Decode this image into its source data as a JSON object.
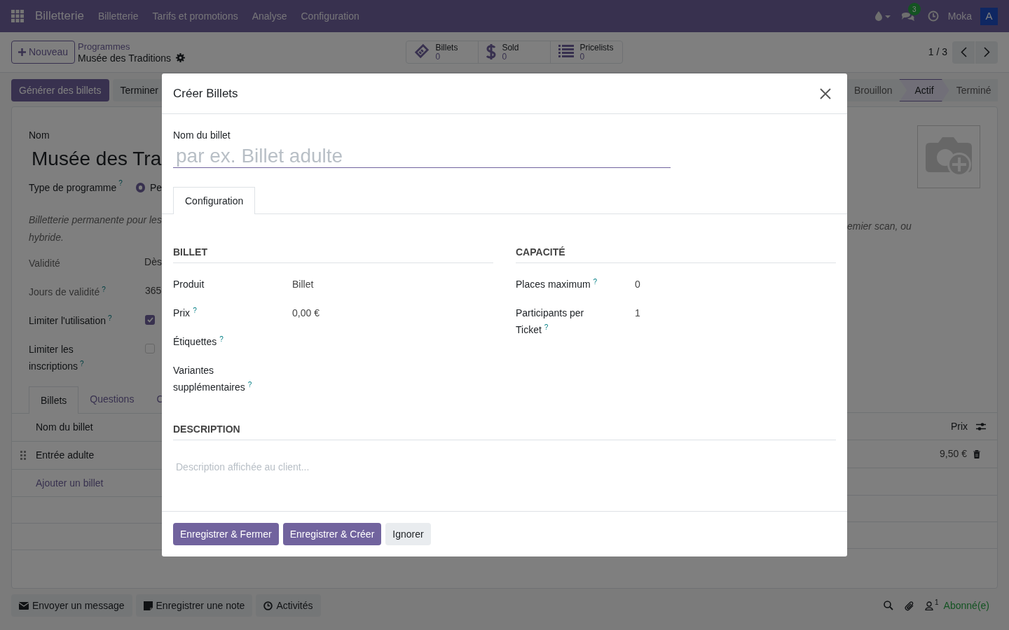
{
  "navbar": {
    "app_name": "Billetterie",
    "menu": [
      "Billetterie",
      "Tarifs et promotions",
      "Analyse",
      "Configuration"
    ],
    "chat_count": "3",
    "company": "Moka",
    "avatar": "A"
  },
  "control_panel": {
    "new_button": "Nouveau",
    "breadcrumb": "Programmes",
    "record_title": "Musée des Traditions",
    "smart_buttons": [
      {
        "kind": "ticket",
        "label": "Billets",
        "value": "0"
      },
      {
        "kind": "dollar",
        "label": "Sold",
        "value": "0"
      },
      {
        "kind": "list",
        "label": "Pricelists",
        "value": "0"
      }
    ],
    "pager": "1 / 3"
  },
  "form": {
    "action_buttons": [
      {
        "label": "Générer des billets",
        "primary": true
      },
      {
        "label": "Terminer",
        "primary": false
      }
    ],
    "stages": [
      {
        "label": "Brouillon",
        "selected": false
      },
      {
        "label": "Actif",
        "selected": true
      },
      {
        "label": "Terminé",
        "selected": false
      }
    ],
    "name_label": "Nom",
    "name_value": "Musée des Tra",
    "program_type": {
      "label": "Type de programme",
      "help": "?",
      "option": "Pe",
      "selected": true
    },
    "description": {
      "left": "Billetterie permanente pour les",
      "right": "emier scan, ou",
      "line2": "hybride."
    },
    "fields": [
      {
        "kind": "text",
        "label": "Validité",
        "muted": true,
        "value": "Dès"
      },
      {
        "kind": "text",
        "label": "Jours de validité",
        "help": "?",
        "muted": true,
        "value": "365"
      },
      {
        "kind": "checkbox",
        "label": "Limiter l'utilisation",
        "help": "?",
        "muted": false,
        "checked": true
      },
      {
        "kind": "checkbox",
        "label": "Limiter les inscriptions",
        "help": "?",
        "muted": false,
        "checked": false
      }
    ],
    "tabs": [
      {
        "label": "Billets",
        "selected": true
      },
      {
        "label": "Questions",
        "selected": false
      },
      {
        "label": "C",
        "selected": false
      }
    ],
    "table": {
      "columns": [
        "Nom du billet",
        "Prix"
      ],
      "rows": [
        {
          "name": "Entrée adulte",
          "price": "9,50 €"
        }
      ],
      "add_line": "Ajouter un billet"
    }
  },
  "chatter": {
    "buttons": [
      {
        "kind": "envelope",
        "label": "Envoyer un message"
      },
      {
        "kind": "note",
        "label": "Enregistrer une note"
      },
      {
        "kind": "clock",
        "label": "Activités"
      }
    ],
    "followers_count": "1",
    "follow_status": "Abonné(e)"
  },
  "dialog": {
    "title": "Créer Billets",
    "name_label": "Nom du billet",
    "name_placeholder": "par ex. Billet adulte",
    "tabs": [
      {
        "label": "Configuration",
        "selected": true
      }
    ],
    "sections": [
      {
        "title": "BILLET",
        "fields": [
          {
            "label": "Produit",
            "value": "Billet"
          },
          {
            "label": "Prix",
            "help": "?",
            "value": "0,00 €"
          },
          {
            "label": "Étiquettes",
            "help": "?"
          },
          {
            "label": "Variantes supplémentaires",
            "help": "?"
          }
        ]
      },
      {
        "title": "CAPACITÉ",
        "fields": [
          {
            "label": "Places maximum",
            "help": "?",
            "value": "0"
          },
          {
            "label": "Participants per Ticket",
            "help": "?",
            "value": "1"
          }
        ]
      }
    ],
    "description_title": "DESCRIPTION",
    "description_placeholder": "Description affichée au client...",
    "buttons": [
      {
        "label": "Enregistrer & Fermer",
        "kind": "primary"
      },
      {
        "label": "Enregistrer & Créer",
        "kind": "primary"
      },
      {
        "label": "Ignorer",
        "kind": "secondary"
      }
    ]
  }
}
